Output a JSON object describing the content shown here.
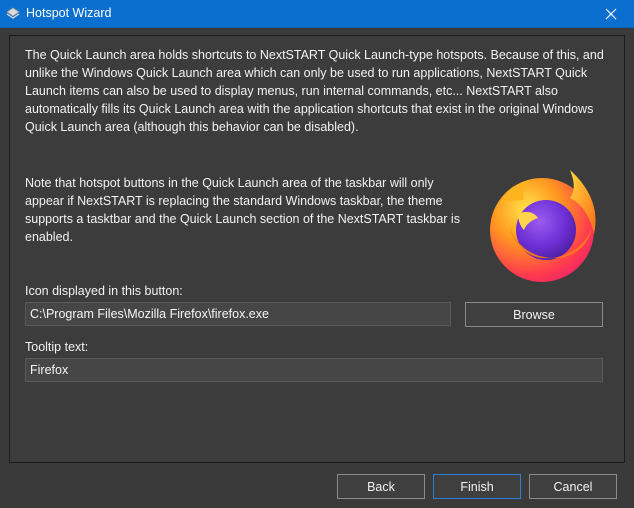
{
  "window": {
    "title": "Hotspot Wizard",
    "icons": {
      "app": "wizard-app-icon",
      "close": "close-icon"
    },
    "colors": {
      "titlebar": "#0a6fcf",
      "background": "#3a3a3a",
      "accent": "#2a7fd6"
    }
  },
  "content": {
    "paragraph1": "The Quick Launch area holds shortcuts to NextSTART Quick Launch-type hotspots. Because of this, and unlike the Windows Quick Launch area which can only be used to run applications, NextSTART Quick Launch items can also be used to display menus, run internal commands, etc... NextSTART also automatically fills its Quick Launch area with the application shortcuts that exist in the original Windows Quick Launch area (although this behavior can be disabled).",
    "paragraph2": "Note that hotspot buttons in the Quick Launch area of the taskbar will only appear if NextSTART is replacing the standard Windows taskbar, the theme supports a tasktbar and the Quick Launch section of the NextSTART taskbar is enabled.",
    "preview_icon": "firefox-logo-icon"
  },
  "form": {
    "icon_label": "Icon displayed in this button:",
    "icon_value": "C:\\Program Files\\Mozilla Firefox\\firefox.exe",
    "browse_label": "Browse",
    "tooltip_label": "Tooltip text:",
    "tooltip_value": "Firefox"
  },
  "footer": {
    "back_label": "Back",
    "finish_label": "Finish",
    "cancel_label": "Cancel"
  }
}
